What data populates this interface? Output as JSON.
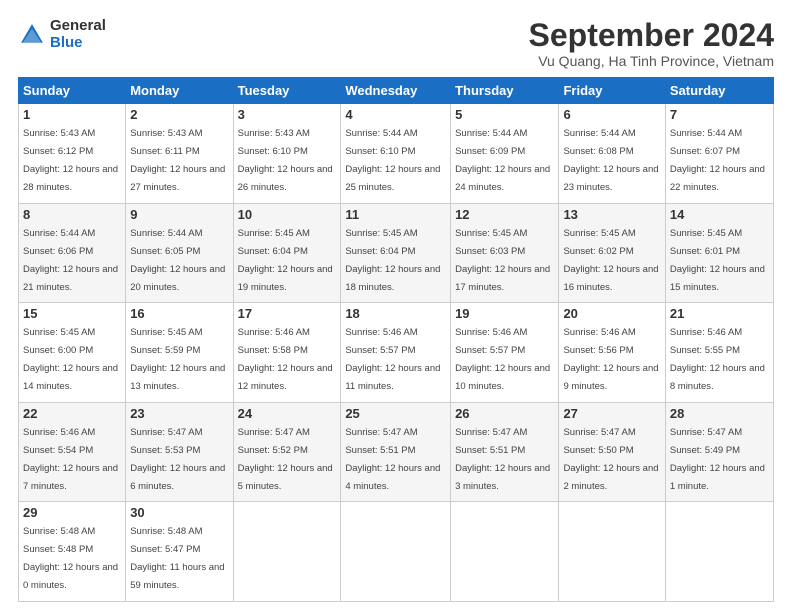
{
  "logo": {
    "general": "General",
    "blue": "Blue"
  },
  "header": {
    "title": "September 2024",
    "subtitle": "Vu Quang, Ha Tinh Province, Vietnam"
  },
  "weekdays": [
    "Sunday",
    "Monday",
    "Tuesday",
    "Wednesday",
    "Thursday",
    "Friday",
    "Saturday"
  ],
  "weeks": [
    [
      {
        "day": "1",
        "sunrise": "5:43 AM",
        "sunset": "6:12 PM",
        "daylight": "12 hours and 28 minutes."
      },
      {
        "day": "2",
        "sunrise": "5:43 AM",
        "sunset": "6:11 PM",
        "daylight": "12 hours and 27 minutes."
      },
      {
        "day": "3",
        "sunrise": "5:43 AM",
        "sunset": "6:10 PM",
        "daylight": "12 hours and 26 minutes."
      },
      {
        "day": "4",
        "sunrise": "5:44 AM",
        "sunset": "6:10 PM",
        "daylight": "12 hours and 25 minutes."
      },
      {
        "day": "5",
        "sunrise": "5:44 AM",
        "sunset": "6:09 PM",
        "daylight": "12 hours and 24 minutes."
      },
      {
        "day": "6",
        "sunrise": "5:44 AM",
        "sunset": "6:08 PM",
        "daylight": "12 hours and 23 minutes."
      },
      {
        "day": "7",
        "sunrise": "5:44 AM",
        "sunset": "6:07 PM",
        "daylight": "12 hours and 22 minutes."
      }
    ],
    [
      {
        "day": "8",
        "sunrise": "5:44 AM",
        "sunset": "6:06 PM",
        "daylight": "12 hours and 21 minutes."
      },
      {
        "day": "9",
        "sunrise": "5:44 AM",
        "sunset": "6:05 PM",
        "daylight": "12 hours and 20 minutes."
      },
      {
        "day": "10",
        "sunrise": "5:45 AM",
        "sunset": "6:04 PM",
        "daylight": "12 hours and 19 minutes."
      },
      {
        "day": "11",
        "sunrise": "5:45 AM",
        "sunset": "6:04 PM",
        "daylight": "12 hours and 18 minutes."
      },
      {
        "day": "12",
        "sunrise": "5:45 AM",
        "sunset": "6:03 PM",
        "daylight": "12 hours and 17 minutes."
      },
      {
        "day": "13",
        "sunrise": "5:45 AM",
        "sunset": "6:02 PM",
        "daylight": "12 hours and 16 minutes."
      },
      {
        "day": "14",
        "sunrise": "5:45 AM",
        "sunset": "6:01 PM",
        "daylight": "12 hours and 15 minutes."
      }
    ],
    [
      {
        "day": "15",
        "sunrise": "5:45 AM",
        "sunset": "6:00 PM",
        "daylight": "12 hours and 14 minutes."
      },
      {
        "day": "16",
        "sunrise": "5:45 AM",
        "sunset": "5:59 PM",
        "daylight": "12 hours and 13 minutes."
      },
      {
        "day": "17",
        "sunrise": "5:46 AM",
        "sunset": "5:58 PM",
        "daylight": "12 hours and 12 minutes."
      },
      {
        "day": "18",
        "sunrise": "5:46 AM",
        "sunset": "5:57 PM",
        "daylight": "12 hours and 11 minutes."
      },
      {
        "day": "19",
        "sunrise": "5:46 AM",
        "sunset": "5:57 PM",
        "daylight": "12 hours and 10 minutes."
      },
      {
        "day": "20",
        "sunrise": "5:46 AM",
        "sunset": "5:56 PM",
        "daylight": "12 hours and 9 minutes."
      },
      {
        "day": "21",
        "sunrise": "5:46 AM",
        "sunset": "5:55 PM",
        "daylight": "12 hours and 8 minutes."
      }
    ],
    [
      {
        "day": "22",
        "sunrise": "5:46 AM",
        "sunset": "5:54 PM",
        "daylight": "12 hours and 7 minutes."
      },
      {
        "day": "23",
        "sunrise": "5:47 AM",
        "sunset": "5:53 PM",
        "daylight": "12 hours and 6 minutes."
      },
      {
        "day": "24",
        "sunrise": "5:47 AM",
        "sunset": "5:52 PM",
        "daylight": "12 hours and 5 minutes."
      },
      {
        "day": "25",
        "sunrise": "5:47 AM",
        "sunset": "5:51 PM",
        "daylight": "12 hours and 4 minutes."
      },
      {
        "day": "26",
        "sunrise": "5:47 AM",
        "sunset": "5:51 PM",
        "daylight": "12 hours and 3 minutes."
      },
      {
        "day": "27",
        "sunrise": "5:47 AM",
        "sunset": "5:50 PM",
        "daylight": "12 hours and 2 minutes."
      },
      {
        "day": "28",
        "sunrise": "5:47 AM",
        "sunset": "5:49 PM",
        "daylight": "12 hours and 1 minute."
      }
    ],
    [
      {
        "day": "29",
        "sunrise": "5:48 AM",
        "sunset": "5:48 PM",
        "daylight": "12 hours and 0 minutes."
      },
      {
        "day": "30",
        "sunrise": "5:48 AM",
        "sunset": "5:47 PM",
        "daylight": "11 hours and 59 minutes."
      },
      null,
      null,
      null,
      null,
      null
    ]
  ]
}
